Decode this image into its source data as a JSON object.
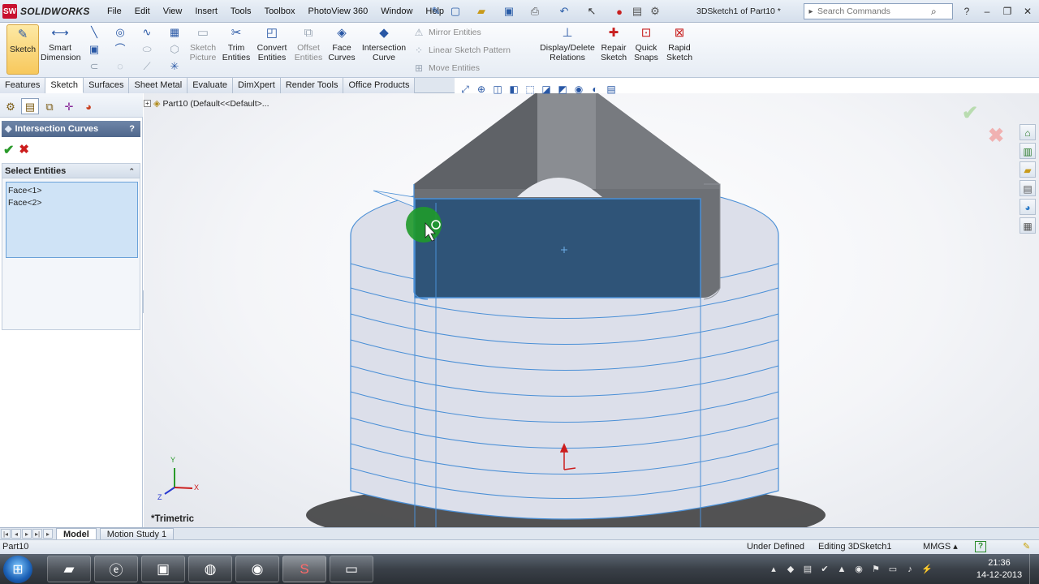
{
  "app": {
    "brand": "SOLIDWORKS",
    "doc_title": "3DSketch1 of Part10 *"
  },
  "menu": [
    "File",
    "Edit",
    "View",
    "Insert",
    "Tools",
    "Toolbox",
    "PhotoView 360",
    "Window",
    "Help"
  ],
  "search": {
    "placeholder": "Search Commands"
  },
  "ribbon": {
    "sketch": "Sketch",
    "smart_dimension": [
      "Smart",
      "Dimension"
    ],
    "sketch_picture": [
      "Sketch",
      "Picture"
    ],
    "trim_entities": [
      "Trim",
      "Entities"
    ],
    "convert_entities": [
      "Convert",
      "Entities"
    ],
    "offset_entities": [
      "Offset",
      "Entities"
    ],
    "face_curves": [
      "Face",
      "Curves"
    ],
    "intersection_curve": [
      "Intersection",
      "Curve"
    ],
    "mirror_entities": "Mirror Entities",
    "linear_sketch_pattern": "Linear Sketch Pattern",
    "move_entities": "Move Entities",
    "display_delete_relations": [
      "Display/Delete",
      "Relations"
    ],
    "repair_sketch": [
      "Repair",
      "Sketch"
    ],
    "quick_snaps": [
      "Quick",
      "Snaps"
    ],
    "rapid_sketch": [
      "Rapid",
      "Sketch"
    ]
  },
  "cm_tabs": [
    "Features",
    "Sketch",
    "Surfaces",
    "Sheet Metal",
    "Evaluate",
    "DimXpert",
    "Render Tools",
    "Office Products"
  ],
  "cm_active": "Sketch",
  "tree_root": "Part10  (Default<<Default>...",
  "property_manager": {
    "title": "Intersection Curves",
    "help": "?",
    "section": "Select Entities",
    "entities": [
      "Face<1>",
      "Face<2>"
    ]
  },
  "view_orientation": "*Trimetric",
  "triad": {
    "x": "X",
    "y": "Y",
    "z": "Z"
  },
  "bottom_tabs": [
    "Model",
    "Motion Study 1"
  ],
  "status": {
    "part": "Part10",
    "state": "Under Defined",
    "mode": "Editing 3DSketch1",
    "units": "MMGS",
    "units_arrow": "▴"
  },
  "clock": {
    "time": "21:36",
    "date": "14-12-2013"
  },
  "colors": {
    "selection_blue": "#2f5478",
    "edge_blue": "#4a8fd6",
    "model_face": "#dcdfea",
    "prism_face": "#6d7075"
  },
  "icons": {
    "ok": "check-icon",
    "cancel": "close-icon"
  }
}
